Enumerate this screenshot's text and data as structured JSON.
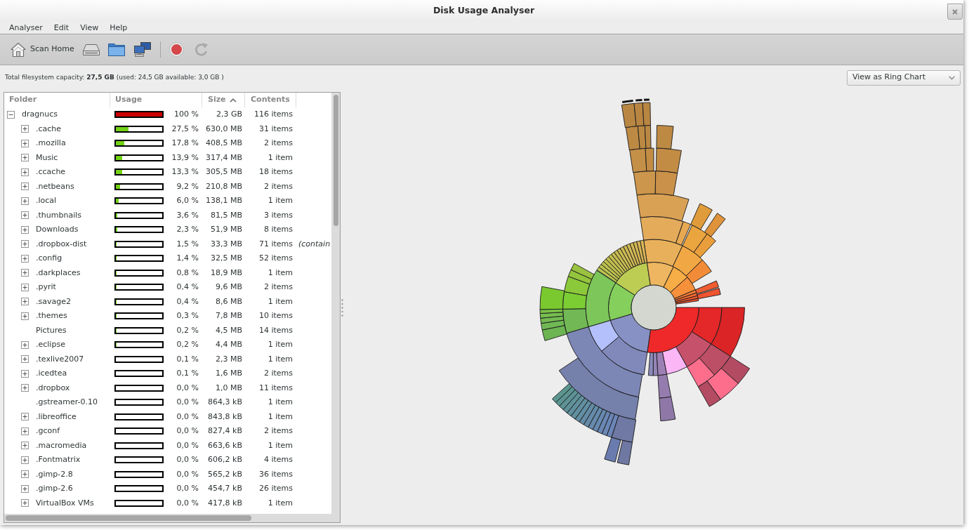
{
  "window": {
    "title": "Disk Usage Analyser"
  },
  "menu_bar": [
    "Analyser",
    "Edit",
    "View",
    "Help"
  ],
  "toolbar": {
    "scan_home_button": {
      "label": "Scan Home"
    }
  },
  "capacity_text": "Total filesystem capacity: **27,5 GB** (used: 24,5 GB available: 3,0 GB )",
  "view_selector": {
    "value": "View as Ring Chart"
  },
  "folder_tree": {
    "columns": [
      {
        "label": "Folder",
        "sorted": false
      },
      {
        "label": "Usage",
        "sorted": false
      },
      {
        "label": "Size",
        "sorted": true
      },
      {
        "label": "Contents",
        "sorted": false
      }
    ],
    "rows": [
      {
        "name": "dragnucs",
        "expandable": true,
        "expanded": true,
        "level": 1,
        "percent": "100 %",
        "size": "2,3 GB",
        "contents": "116 items",
        "children": [
          {
            "name": ".cache",
            "expandable": true,
            "expanded": false,
            "level": 0.275,
            "percent": "27,5 %",
            "size": "630,0 MB",
            "contents": "31 items"
          },
          {
            "name": ".mozilla",
            "expandable": true,
            "expanded": false,
            "level": 0.178,
            "percent": "17,8 %",
            "size": "408,5 MB",
            "contents": "2 items"
          },
          {
            "name": "Music",
            "expandable": true,
            "expanded": false,
            "level": 0.139,
            "percent": "13,9 %",
            "size": "317,4 MB",
            "contents": "1 item"
          },
          {
            "name": ".ccache",
            "expandable": true,
            "expanded": false,
            "level": 0.133,
            "percent": "13,3 %",
            "size": "305,5 MB",
            "contents": "18 items"
          },
          {
            "name": ".netbeans",
            "expandable": true,
            "expanded": false,
            "level": 0.092,
            "percent": "9,2 %",
            "size": "210,8 MB",
            "contents": "2 items"
          },
          {
            "name": ".local",
            "expandable": true,
            "expanded": false,
            "level": 0.06,
            "percent": "6,0 %",
            "size": "138,1 MB",
            "contents": "1 item"
          },
          {
            "name": ".thumbnails",
            "expandable": true,
            "expanded": false,
            "level": 0.036,
            "percent": "3,6 %",
            "size": "81,5 MB",
            "contents": "3 items"
          },
          {
            "name": "Downloads",
            "expandable": true,
            "expanded": false,
            "level": 0.023,
            "percent": "2,3 %",
            "size": "51,9 MB",
            "contents": "8 items"
          },
          {
            "name": ".dropbox-dist",
            "expandable": true,
            "expanded": false,
            "level": 0.015,
            "percent": "1,5 %",
            "size": "33,3 MB",
            "contents": "71 items",
            "column_5": "(contain"
          },
          {
            "name": ".config",
            "expandable": true,
            "expanded": false,
            "level": 0.014,
            "percent": "1,4 %",
            "size": "32,5 MB",
            "contents": "52 items"
          },
          {
            "name": ".darkplaces",
            "expandable": true,
            "expanded": false,
            "level": 0.008,
            "percent": "0,8 %",
            "size": "18,9 MB",
            "contents": "1 item"
          },
          {
            "name": ".pyrit",
            "expandable": true,
            "expanded": false,
            "level": 0.004,
            "percent": "0,4 %",
            "size": "9,6 MB",
            "contents": "2 items"
          },
          {
            "name": ".savage2",
            "expandable": true,
            "expanded": false,
            "level": 0.004,
            "percent": "0,4 %",
            "size": "8,6 MB",
            "contents": "1 item"
          },
          {
            "name": ".themes",
            "expandable": true,
            "expanded": false,
            "level": 0.003,
            "percent": "0,3 %",
            "size": "7,8 MB",
            "contents": "10 items"
          },
          {
            "name": "Pictures",
            "expandable": false,
            "level": 0.002,
            "percent": "0,2 %",
            "size": "4,5 MB",
            "contents": "14 items"
          },
          {
            "name": ".eclipse",
            "expandable": true,
            "expanded": false,
            "level": 0.002,
            "percent": "0,2 %",
            "size": "4,4 MB",
            "contents": "1 item"
          },
          {
            "name": ".texlive2007",
            "expandable": true,
            "expanded": false,
            "level": 0.001,
            "percent": "0,1 %",
            "size": "2,3 MB",
            "contents": "1 item"
          },
          {
            "name": ".icedtea",
            "expandable": true,
            "expanded": false,
            "level": 0.001,
            "percent": "0,1 %",
            "size": "1,6 MB",
            "contents": "2 items"
          },
          {
            "name": ".dropbox",
            "expandable": true,
            "expanded": false,
            "level": 0,
            "percent": "0,0 %",
            "size": "1,0 MB",
            "contents": "11 items"
          },
          {
            "name": ".gstreamer-0.10",
            "expandable": false,
            "level": 0,
            "percent": "0,0 %",
            "size": "864,3 kB",
            "contents": "1 item"
          },
          {
            "name": ".libreoffice",
            "expandable": true,
            "expanded": false,
            "level": 0,
            "percent": "0,0 %",
            "size": "843,8 kB",
            "contents": "1 item"
          },
          {
            "name": ".gconf",
            "expandable": true,
            "expanded": false,
            "level": 0,
            "percent": "0,0 %",
            "size": "827,4 kB",
            "contents": "2 items"
          },
          {
            "name": ".macromedia",
            "expandable": true,
            "expanded": false,
            "level": 0,
            "percent": "0,0 %",
            "size": "663,6 kB",
            "contents": "1 item"
          },
          {
            "name": ".Fontmatrix",
            "expandable": true,
            "expanded": false,
            "level": 0,
            "percent": "0,0 %",
            "size": "606,2 kB",
            "contents": "4 items"
          },
          {
            "name": ".gimp-2.8",
            "expandable": true,
            "expanded": false,
            "level": 0,
            "percent": "0,0 %",
            "size": "565,2 kB",
            "contents": "36 items"
          },
          {
            "name": ".gimp-2.6",
            "expandable": true,
            "expanded": false,
            "level": 0,
            "percent": "0,0 %",
            "size": "454,7 kB",
            "contents": "26 items"
          },
          {
            "name": "VirtualBox VMs",
            "expandable": true,
            "expanded": false,
            "level": 0,
            "percent": "0,0 %",
            "size": "417,8 kB",
            "contents": "1 item"
          }
        ]
      }
    ]
  }
}
